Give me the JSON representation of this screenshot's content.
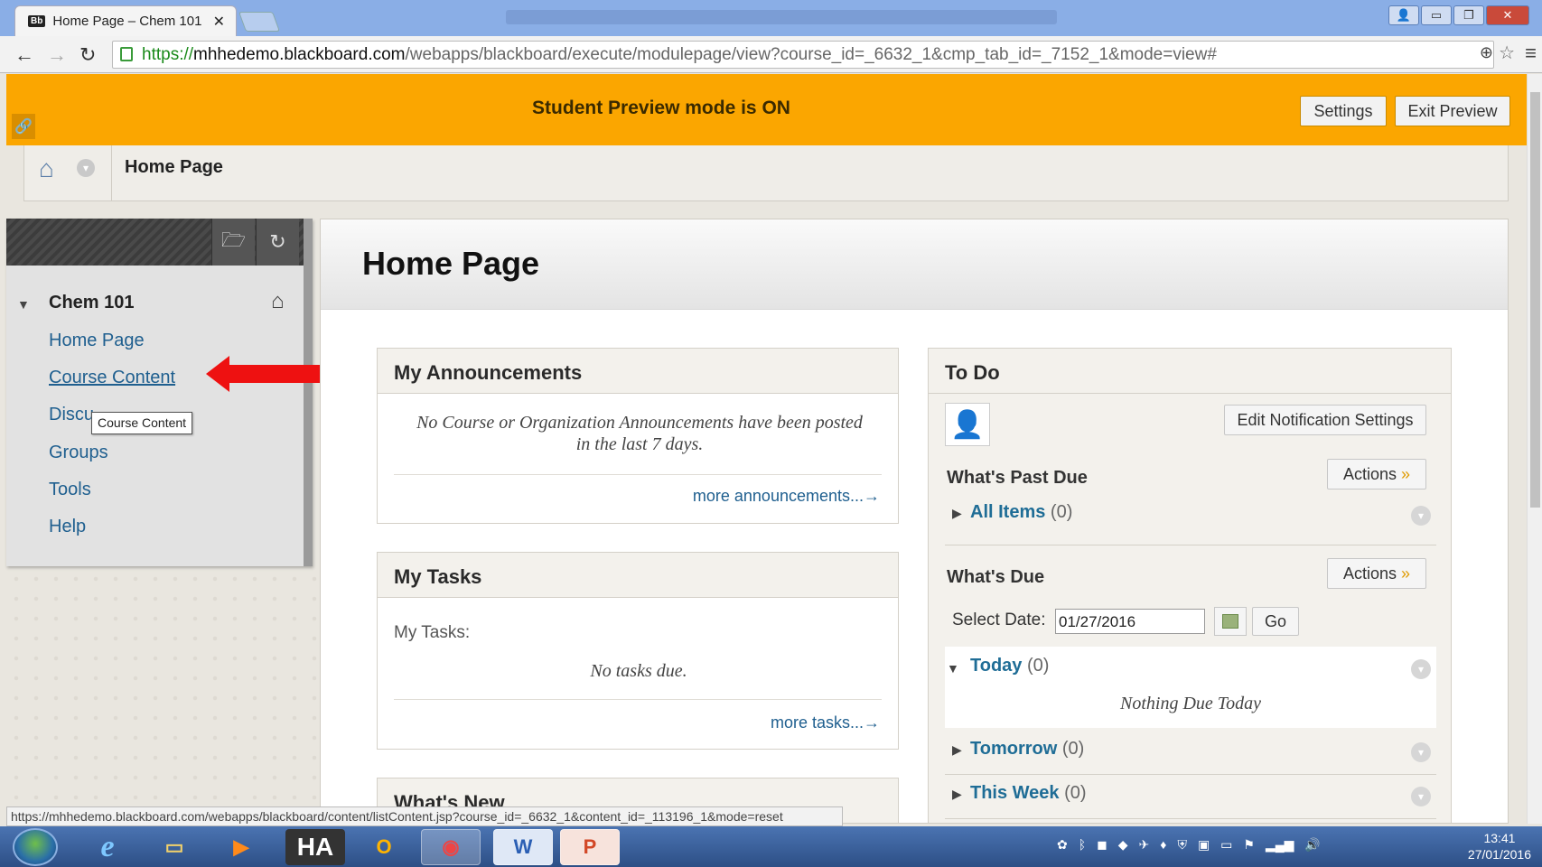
{
  "browser": {
    "tab_title": "Home Page – Chem 101",
    "tab_badge": "Bb",
    "url_scheme": "https://",
    "url_host": "mhhedemo.blackboard.com",
    "url_path": "/webapps/blackboard/execute/modulepage/view?course_id=_6632_1&cmp_tab_id=_7152_1&mode=view#",
    "status_url": "https://mhhedemo.blackboard.com/webapps/blackboard/content/listContent.jsp?course_id=_6632_1&content_id=_113196_1&mode=reset"
  },
  "preview": {
    "message": "Student Preview mode is ON",
    "settings_label": "Settings",
    "exit_label": "Exit Preview"
  },
  "breadcrumb": {
    "title": "Home Page"
  },
  "course_menu": {
    "course_name": "Chem 101",
    "items": [
      {
        "label": "Home Page"
      },
      {
        "label": "Course Content"
      },
      {
        "label": "Discu"
      },
      {
        "label": "Groups"
      },
      {
        "label": "Tools"
      },
      {
        "label": "Help"
      }
    ],
    "tooltip": "Course Content"
  },
  "main": {
    "title": "Home Page",
    "announcements": {
      "title": "My Announcements",
      "empty_text": "No Course or Organization Announcements have been posted in the last 7 days.",
      "more_link": "more announcements...→"
    },
    "tasks": {
      "title": "My Tasks",
      "label": "My Tasks:",
      "empty_text": "No tasks due.",
      "more_link": "more tasks...→"
    },
    "whats_new": {
      "title": "What's New"
    },
    "todo": {
      "title": "To Do",
      "edit_notifications": "Edit Notification Settings",
      "past_due_title": "What's Past Due",
      "actions_label": "Actions",
      "all_items_label": "All Items",
      "all_items_count": "(0)",
      "due_title": "What's Due",
      "select_date_label": "Select Date:",
      "select_date_value": "01/27/2016",
      "go_label": "Go",
      "today_label": "Today",
      "today_count": "(0)",
      "nothing_due": "Nothing Due Today",
      "tomorrow_label": "Tomorrow",
      "tomorrow_count": "(0)",
      "week_label": "This Week",
      "week_count": "(0)"
    }
  },
  "taskbar": {
    "apps": [
      "e",
      "▭",
      "▶",
      "HA",
      "O",
      "◉",
      "W",
      "P"
    ],
    "time": "13:41",
    "date": "27/01/2016"
  }
}
